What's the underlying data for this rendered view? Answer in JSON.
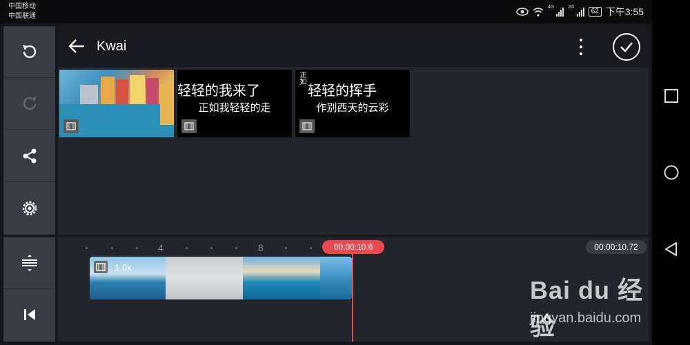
{
  "status_bar": {
    "carrier1": "中国移动",
    "carrier2": "中国联通",
    "net1": "4G",
    "net2": "2G",
    "battery": "62",
    "time": "下午3:55"
  },
  "header": {
    "title": "Kwai"
  },
  "sidebar": {
    "items": [
      {
        "icon": "undo-icon"
      },
      {
        "icon": "redo-icon"
      },
      {
        "icon": "share-icon"
      },
      {
        "icon": "settings-icon"
      }
    ],
    "bottom_items": [
      {
        "icon": "split-icon"
      },
      {
        "icon": "skip-to-start-icon"
      }
    ]
  },
  "media": {
    "clips": [
      {
        "type": "image",
        "line1": "",
        "line2": ""
      },
      {
        "type": "text",
        "line1": "轻轻的我来了",
        "line2": "正如我轻轻的走"
      },
      {
        "type": "text",
        "line1": "轻轻的挥手",
        "line2": "作别西天的云彩",
        "side_text": "正如"
      }
    ]
  },
  "timeline": {
    "tick_labels": [
      "4",
      "8"
    ],
    "playhead_time": "00:00:10.6",
    "duration": "00:00:10.72",
    "speed": "1.0x"
  },
  "watermark": {
    "brand": "Bai du 经验",
    "url": "jingyan.baidu.com"
  },
  "colors": {
    "accent": "#e84a4f",
    "background": "#16171c",
    "panel": "#23252d"
  }
}
